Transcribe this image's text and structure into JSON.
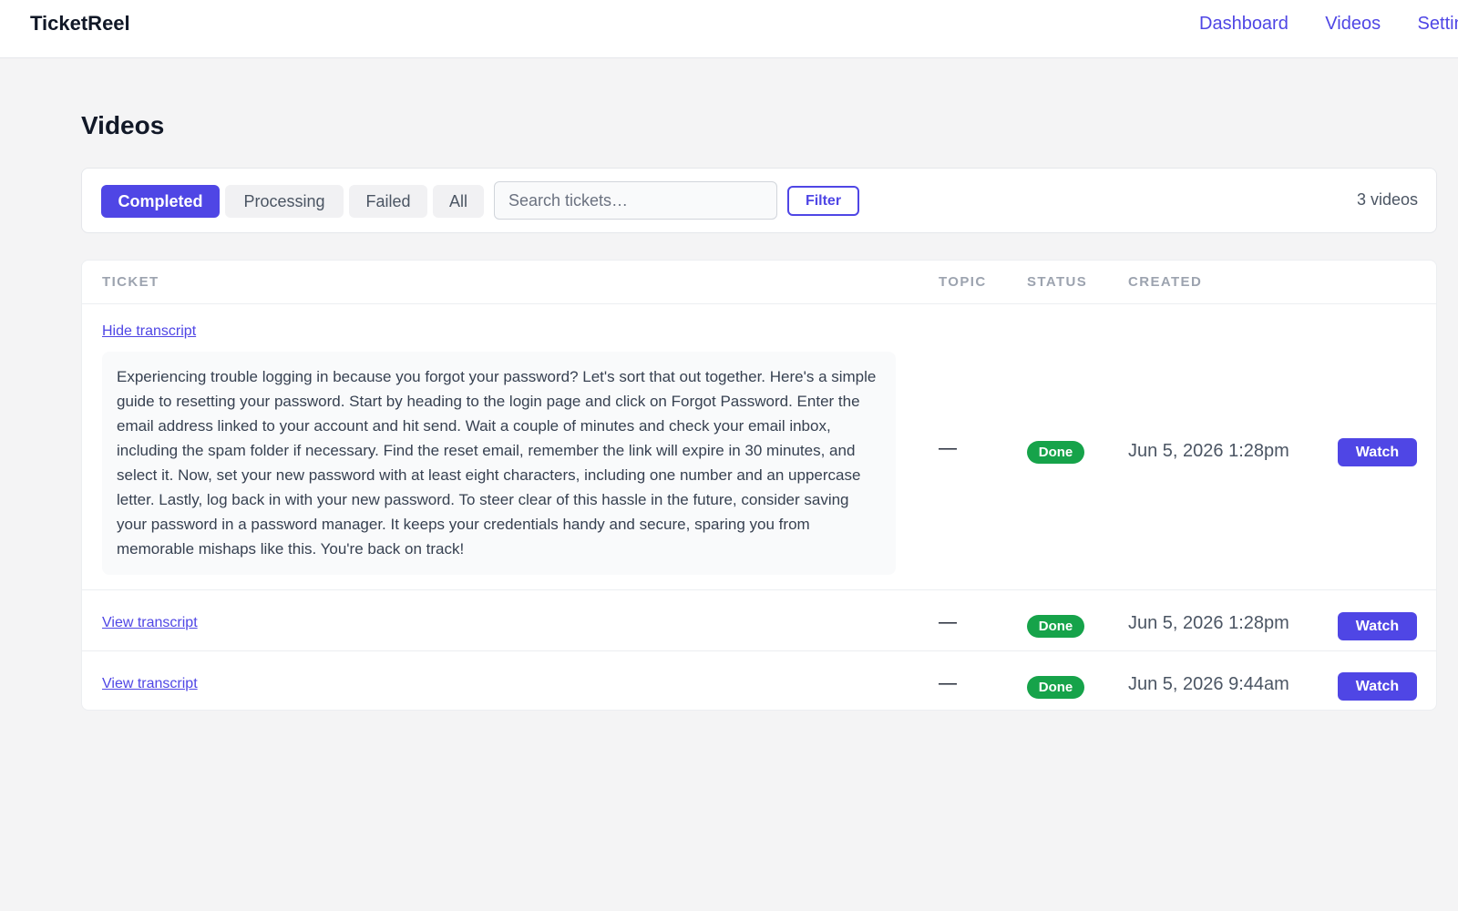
{
  "app": {
    "brand": "TicketReel"
  },
  "nav": {
    "items": [
      "Dashboard",
      "Videos",
      "Settings"
    ]
  },
  "page": {
    "title": "Videos"
  },
  "filters": {
    "tabs": [
      "Completed",
      "Processing",
      "Failed",
      "All"
    ],
    "active_tab": "Completed",
    "search_placeholder": "Search tickets…",
    "search_value": "",
    "filter_label": "Filter",
    "count_label": "3 videos"
  },
  "table": {
    "headers": {
      "ticket": "TICKET",
      "topic": "TOPIC",
      "status": "STATUS",
      "created": "CREATED"
    },
    "rows": [
      {
        "link_label": "Hide transcript",
        "transcript": "Experiencing trouble logging in because you forgot your password? Let's sort that out together. Here's a simple guide to resetting your password. Start by heading to the login page and click on Forgot Password. Enter the email address linked to your account and hit send. Wait a couple of minutes and check your email inbox, including the spam folder if necessary. Find the reset email, remember the link will expire in 30 minutes, and select it. Now, set your new password with at least eight characters, including one number and an uppercase letter. Lastly, log back in with your new password. To steer clear of this hassle in the future, consider saving your password in a password manager. It keeps your credentials handy and secure, sparing you from memorable mishaps like this. You're back on track!",
        "topic": "—",
        "status": "Done",
        "created": "Jun 5, 2026 1:28pm",
        "action": "Watch"
      },
      {
        "link_label": "View transcript",
        "topic": "—",
        "status": "Done",
        "created": "Jun 5, 2026 1:28pm",
        "action": "Watch"
      },
      {
        "link_label": "View transcript",
        "topic": "—",
        "status": "Done",
        "created": "Jun 5, 2026 9:44am",
        "action": "Watch"
      }
    ]
  },
  "colors": {
    "accent": "#4f46e5",
    "success": "#16a34a",
    "background": "#f4f4f5"
  }
}
